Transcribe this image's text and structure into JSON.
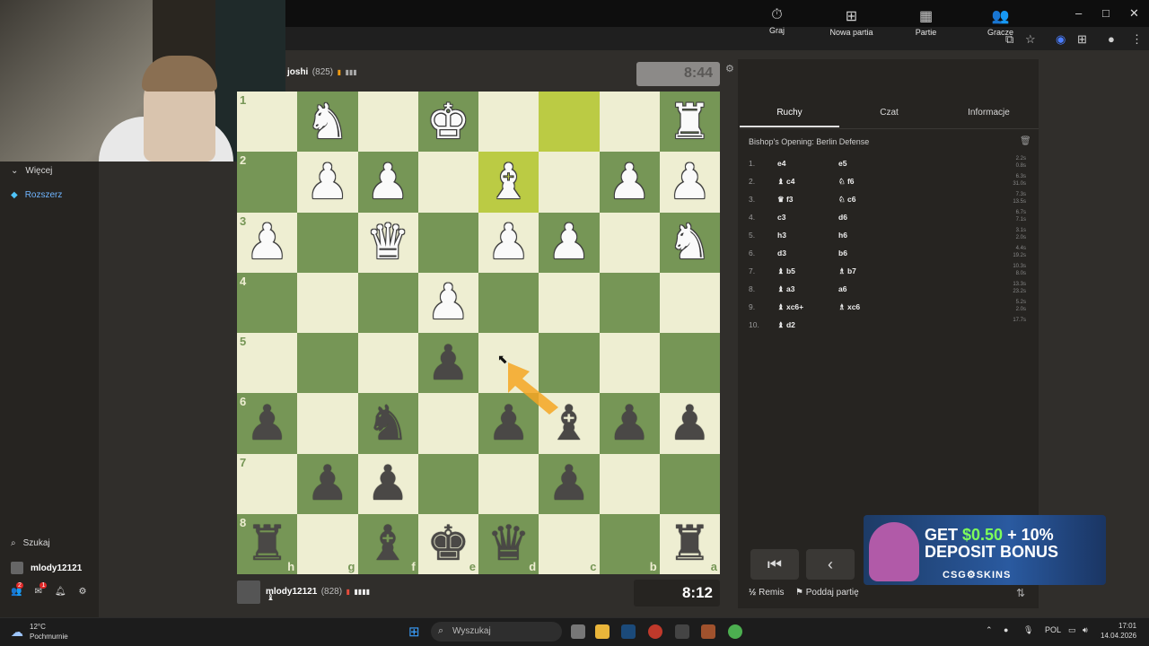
{
  "browser": {
    "window_controls": [
      "–",
      "□",
      "✕"
    ]
  },
  "sidebar": {
    "more_label": "Więcej",
    "extend_label": "Rozszerz",
    "search_label": "Szukaj",
    "username": "mlody12121",
    "friends_badge": "2",
    "mail_badge": "1"
  },
  "game": {
    "top_player": {
      "name": "joshi",
      "rating": "(825)"
    },
    "bottom_player": {
      "name": "mlody12121",
      "rating": "(828)"
    },
    "top_clock": "8:44",
    "bottom_clock": "8:12",
    "board": {
      "orientation": "black",
      "ranks": [
        "1",
        "2",
        "3",
        "4",
        "5",
        "6",
        "7",
        "8"
      ],
      "files": [
        "h",
        "g",
        "f",
        "e",
        "d",
        "c",
        "b",
        "a"
      ],
      "rows": [
        [
          "",
          "wN",
          "",
          "wK",
          "",
          "",
          "",
          "wR"
        ],
        [
          "",
          "wP",
          "wP",
          "",
          "wB",
          "",
          "wP",
          "wP"
        ],
        [
          "wP",
          "",
          "wQ",
          "",
          "wP",
          "wP",
          "",
          "wN"
        ],
        [
          "",
          "",
          "",
          "wP",
          "",
          "",
          "",
          ""
        ],
        [
          "",
          "",
          "",
          "bP",
          "",
          "",
          "",
          ""
        ],
        [
          "bP",
          "",
          "bN",
          "",
          "bP",
          "bB",
          "bP",
          "bP"
        ],
        [
          "",
          "bP",
          "bP",
          "",
          "",
          "bP",
          "",
          ""
        ],
        [
          "bR",
          "",
          "bB",
          "bK",
          "bQ",
          "",
          "",
          "bR"
        ]
      ],
      "highlights": [
        [
          0,
          5
        ],
        [
          1,
          4
        ]
      ]
    }
  },
  "panel": {
    "tabs": [
      {
        "label": "Graj",
        "icon": "stopwatch-icon"
      },
      {
        "label": "Nowa partia",
        "icon": "plus-square-icon"
      },
      {
        "label": "Partie",
        "icon": "board-icon"
      },
      {
        "label": "Gracze",
        "icon": "users-icon"
      }
    ],
    "subtabs": [
      "Ruchy",
      "Czat",
      "Informacje"
    ],
    "opening": "Bishop's Opening: Berlin Defense",
    "moves": [
      {
        "n": "1.",
        "w": "e4",
        "b": "e5",
        "tw": "2.2s",
        "tb": "0.8s"
      },
      {
        "n": "2.",
        "w": "♝ c4",
        "b": "♘ f6",
        "tw": "6.3s",
        "tb": "31.0s"
      },
      {
        "n": "3.",
        "w": "♛ f3",
        "b": "♘ c6",
        "tw": "7.3s",
        "tb": "13.5s"
      },
      {
        "n": "4.",
        "w": "c3",
        "b": "d6",
        "tw": "6.7s",
        "tb": "7.1s"
      },
      {
        "n": "5.",
        "w": "h3",
        "b": "h6",
        "tw": "3.1s",
        "tb": "2.0s"
      },
      {
        "n": "6.",
        "w": "d3",
        "b": "b6",
        "tw": "4.4s",
        "tb": "19.2s"
      },
      {
        "n": "7.",
        "w": "♝ b5",
        "b": "♗ b7",
        "tw": "10.3s",
        "tb": "8.0s"
      },
      {
        "n": "8.",
        "w": "♝ a3",
        "b": "a6",
        "tw": "13.3s",
        "tb": "23.2s"
      },
      {
        "n": "9.",
        "w": "♝ xc6+",
        "b": "♗ xc6",
        "tw": "5.2s",
        "tb": "2.0s"
      },
      {
        "n": "10.",
        "w": "♝ d2",
        "b": "",
        "tw": "17.7s",
        "tb": ""
      }
    ],
    "draw_label": "Remis",
    "draw_prefix": "½",
    "resign_label": "Poddaj partię"
  },
  "ad": {
    "line1_prefix": "GET ",
    "line1_amount": "$0.50",
    "line1_suffix": " + 10%",
    "line2": "DEPOSIT BONUS",
    "brand": "CSG⚙SKINS"
  },
  "taskbar": {
    "weather_temp": "12°C",
    "weather_desc": "Pochmurnie",
    "search_placeholder": "Wyszukaj",
    "lang": "POL",
    "time": "17:01",
    "date": "14.04.2026"
  }
}
